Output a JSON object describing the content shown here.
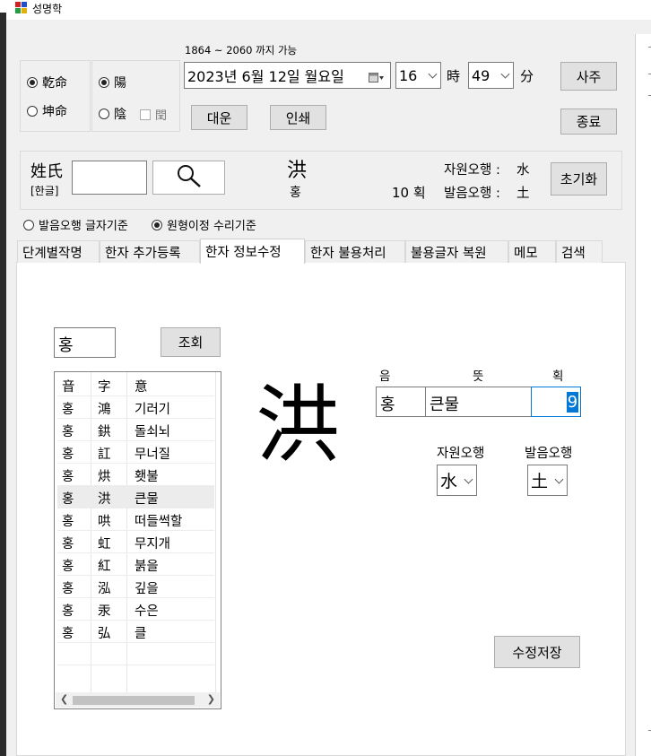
{
  "window": {
    "title": "성명학"
  },
  "birth": {
    "range_note": "1864 ~ 2060 까지 가능",
    "date_value": "2023년   6월 12일 월요일",
    "hour_value": "16",
    "hour_suffix": "時",
    "minute_value": "49",
    "minute_suffix": "分",
    "gender_options": [
      "乾命",
      "坤命"
    ],
    "gender_selected": "乾命",
    "yinyang_options": [
      "陽",
      "陰"
    ],
    "yinyang_selected": "陽",
    "leap_label": "閏"
  },
  "buttons": {
    "saju": "사주",
    "daeun": "대운",
    "print": "인쇄",
    "exit": "종료",
    "reset": "초기화",
    "lookup": "조회",
    "save_edit": "수정저장"
  },
  "name_box": {
    "surname_label": "姓氏",
    "hangul_label": "[한글]",
    "surname_value": "",
    "surname_hanja": "洪",
    "surname_reading": "홍",
    "stroke_text": "10 획",
    "source_element_label": "자원오행 :",
    "source_element_value": "水",
    "sound_element_label": "발음오행 :",
    "sound_element_value": "土"
  },
  "criteria": {
    "options": [
      "발음오행 글자기준",
      "원형이정 수리기준"
    ],
    "selected": "원형이정 수리기준"
  },
  "tabs": [
    "단계별작명",
    "한자 추가등록",
    "한자 정보수정",
    "한자 불용처리",
    "불용글자 복원",
    "메모",
    "검색"
  ],
  "active_tab": "한자 정보수정",
  "search": {
    "value": "홍"
  },
  "hanja_list": {
    "columns": [
      "音",
      "字",
      "意"
    ],
    "rows": [
      [
        "홍",
        "鴻",
        "기러기"
      ],
      [
        "홍",
        "鉷",
        "돌쇠뇌"
      ],
      [
        "홍",
        "訌",
        "무너질"
      ],
      [
        "홍",
        "烘",
        "횃불"
      ],
      [
        "홍",
        "洪",
        "큰물"
      ],
      [
        "홍",
        "哄",
        "떠들썩할"
      ],
      [
        "홍",
        "虹",
        "무지개"
      ],
      [
        "홍",
        "紅",
        "붉을"
      ],
      [
        "홍",
        "泓",
        "깊을"
      ],
      [
        "홍",
        "汞",
        "수은"
      ],
      [
        "홍",
        "弘",
        "클"
      ]
    ],
    "selected_index": 4
  },
  "editor": {
    "big_char": "洪",
    "col_sound": "음",
    "col_meaning": "뜻",
    "col_strokes": "획",
    "sound_value": "홍",
    "meaning_value": "큰물",
    "strokes_value": "9",
    "source_element_label": "자원오행",
    "source_element_value": "水",
    "sound_element_label": "발음오행",
    "sound_element_value": "土"
  }
}
